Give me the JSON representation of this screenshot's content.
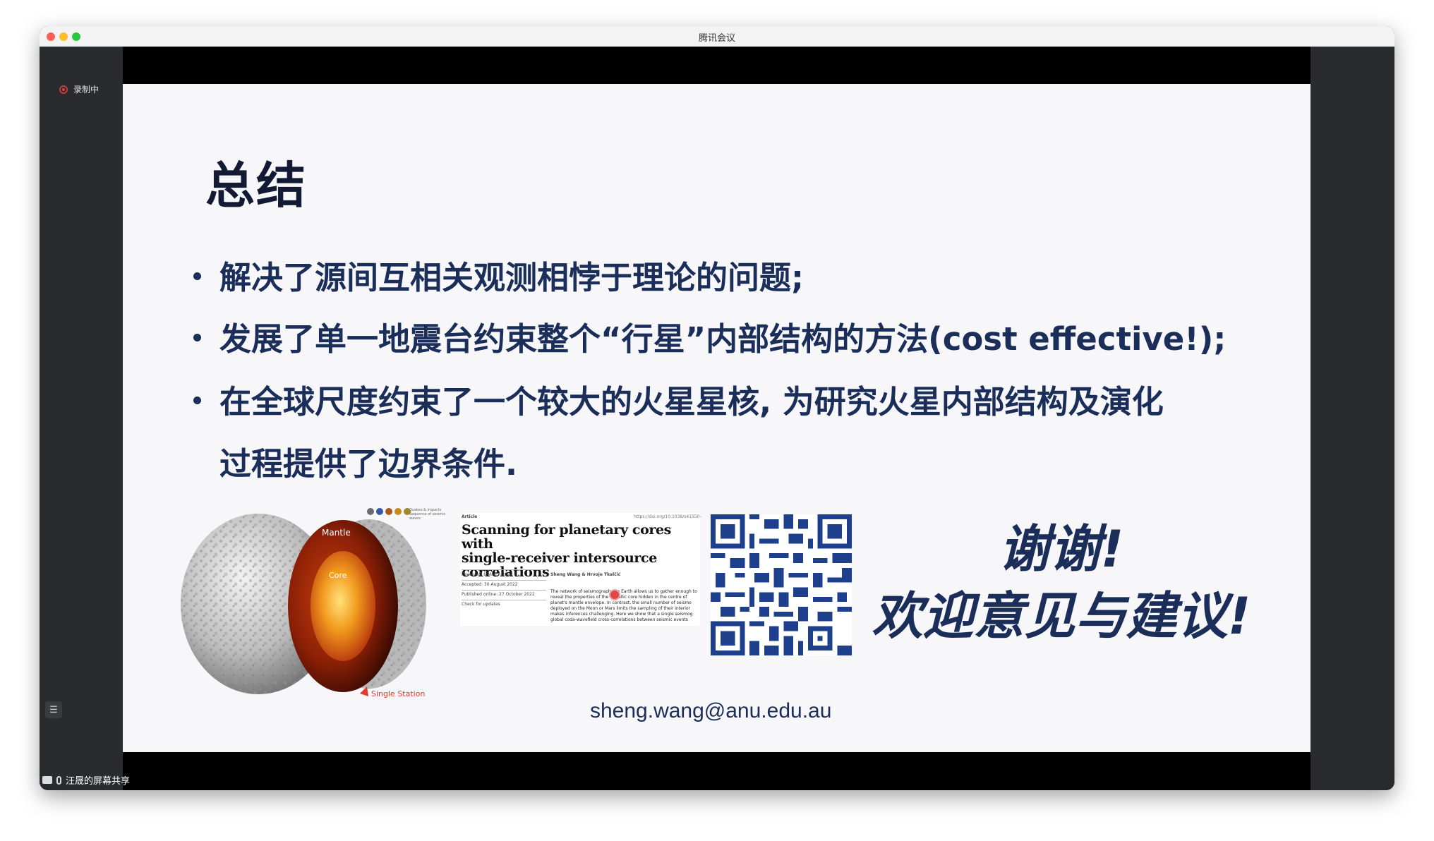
{
  "window": {
    "title": "腾讯会议",
    "recording_label": "录制中",
    "share_status": "汪晟的屏幕共享"
  },
  "slide": {
    "title": "总结",
    "bullets": [
      "解决了源间互相关观测相悖于理论的问题;",
      "发展了单一地震台约束整个“行星”内部结构的方法(cost effective!);",
      "在全球尺度约束了一个较大的火星星核, 为研究火星内部结构及演化",
      "过程提供了边界条件."
    ],
    "figure_labels": {
      "mantle": "Mantle",
      "core": "Core",
      "single_station": "Single Station",
      "legend_line1": "Quakes & impacts",
      "legend_line2": "Sequence of seismic waves"
    },
    "paper": {
      "type": "Article",
      "doi": "https://doi.org/10.1038/s41550-",
      "title_line1": "Scanning for planetary cores with",
      "title_line2": "single-receiver intersource correlations",
      "received": "Received: 6 March 2022",
      "accepted": "Accepted: 30 August 2022",
      "published": "Published online: 27 October 2022",
      "check": "Check for updates",
      "authors": "Sheng Wang & Hrvoje Tkalčić",
      "abstract": "The network of seismographs on Earth allows us to gather enough to reveal the properties of the metallic core hidden in the centre of planet's mantle envelope. In contrast, the small number of seismo deployed on the Moon or Mars limits the sampling of their interior makes inferences challenging. Here we show that a single seismog global coda-wavefield cross-correlations between seismic events"
    },
    "thanks_line1": "谢谢!",
    "thanks_line2": "欢迎意见与建议!",
    "email": "sheng.wang@anu.edu.au"
  },
  "colors": {
    "slide_text": "#1b2e5a",
    "title_text": "#121b33",
    "window_frame": "#2a2b2f",
    "qr_blue": "#1d3f8c"
  }
}
